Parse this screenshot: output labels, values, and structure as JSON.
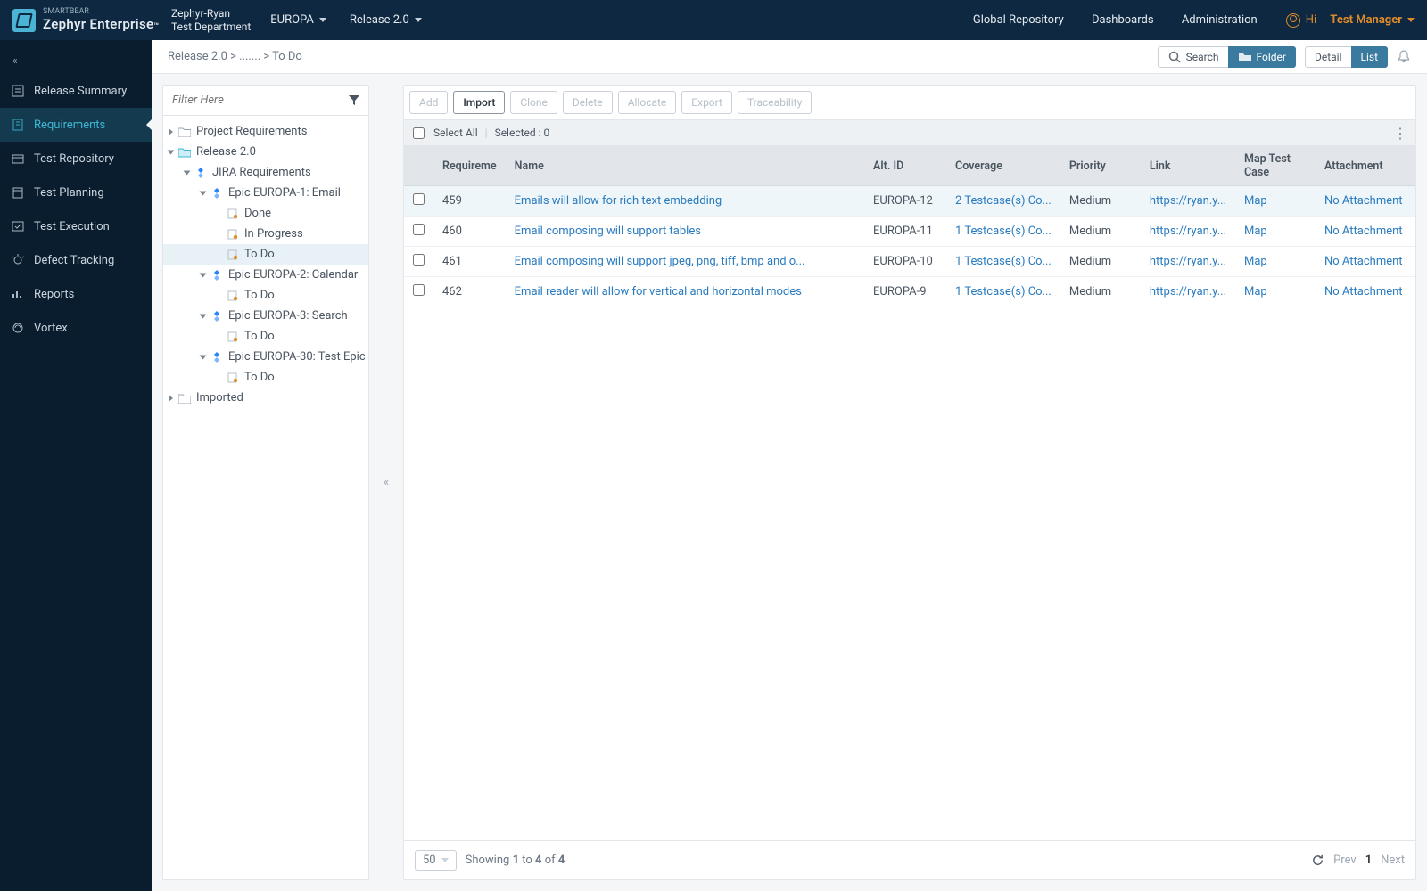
{
  "brand": {
    "small": "SMARTBEAR",
    "name": "Zephyr Enterprise",
    "tm": "™"
  },
  "project": {
    "name": "Zephyr-Ryan",
    "dept": "Test Department"
  },
  "dd1": "EUROPA",
  "dd2": "Release 2.0",
  "topnav": {
    "repo": "Global Repository",
    "dash": "Dashboards",
    "admin": "Administration"
  },
  "user": {
    "greet": "Hi",
    "name": "Test Manager"
  },
  "sidenav": [
    {
      "id": "release-summary",
      "label": "Release Summary"
    },
    {
      "id": "requirements",
      "label": "Requirements"
    },
    {
      "id": "test-repository",
      "label": "Test Repository"
    },
    {
      "id": "test-planning",
      "label": "Test Planning"
    },
    {
      "id": "test-execution",
      "label": "Test Execution"
    },
    {
      "id": "defect-tracking",
      "label": "Defect Tracking"
    },
    {
      "id": "reports",
      "label": "Reports"
    },
    {
      "id": "vortex",
      "label": "Vortex"
    }
  ],
  "breadcrumb": "Release 2.0 > ....... > To Do",
  "searchBtn": "Search",
  "folderBtn": "Folder",
  "detailBtn": "Detail",
  "listBtn": "List",
  "filterPlaceholder": "Filter Here",
  "tree": [
    {
      "d": 0,
      "tw": "closed",
      "ico": "folder",
      "label": "Project Requirements"
    },
    {
      "d": 0,
      "tw": "open",
      "ico": "folder-open",
      "label": "Release 2.0"
    },
    {
      "d": 1,
      "tw": "open",
      "ico": "jira",
      "label": "JIRA Requirements"
    },
    {
      "d": 2,
      "tw": "open",
      "ico": "jira",
      "label": "Epic EUROPA-1: Email"
    },
    {
      "d": 3,
      "tw": "none",
      "ico": "doc",
      "label": "Done"
    },
    {
      "d": 3,
      "tw": "none",
      "ico": "doc",
      "label": "In Progress"
    },
    {
      "d": 3,
      "tw": "none",
      "ico": "doc",
      "label": "To Do",
      "sel": true
    },
    {
      "d": 2,
      "tw": "open",
      "ico": "jira",
      "label": "Epic EUROPA-2: Calendar"
    },
    {
      "d": 3,
      "tw": "none",
      "ico": "doc",
      "label": "To Do"
    },
    {
      "d": 2,
      "tw": "open",
      "ico": "jira",
      "label": "Epic EUROPA-3: Search"
    },
    {
      "d": 3,
      "tw": "none",
      "ico": "doc",
      "label": "To Do"
    },
    {
      "d": 2,
      "tw": "open",
      "ico": "jira",
      "label": "Epic EUROPA-30: Test Epic"
    },
    {
      "d": 3,
      "tw": "none",
      "ico": "doc",
      "label": "To Do"
    },
    {
      "d": 0,
      "tw": "closed",
      "ico": "folder",
      "label": "Imported"
    }
  ],
  "actions": {
    "add": "Add",
    "import": "Import",
    "clone": "Clone",
    "delete": "Delete",
    "allocate": "Allocate",
    "export": "Export",
    "trace": "Traceability"
  },
  "selectAll": "Select All",
  "selected": "Selected : 0",
  "cols": {
    "id": "Requireme",
    "name": "Name",
    "alt": "Alt. ID",
    "cov": "Coverage",
    "pri": "Priority",
    "link": "Link",
    "map": "Map Test Case",
    "att": "Attachment"
  },
  "rows": [
    {
      "id": "459",
      "name": "Emails will allow for rich text embedding",
      "alt": "EUROPA-12",
      "cov": "2 Testcase(s) Co...",
      "pri": "Medium",
      "link": "https://ryan.y...",
      "map": "Map",
      "att": "No Attachment"
    },
    {
      "id": "460",
      "name": "Email composing will support tables",
      "alt": "EUROPA-11",
      "cov": "1 Testcase(s) Co...",
      "pri": "Medium",
      "link": "https://ryan.y...",
      "map": "Map",
      "att": "No Attachment"
    },
    {
      "id": "461",
      "name": "Email composing will support jpeg, png, tiff, bmp and o...",
      "alt": "EUROPA-10",
      "cov": "1 Testcase(s) Co...",
      "pri": "Medium",
      "link": "https://ryan.y...",
      "map": "Map",
      "att": "No Attachment"
    },
    {
      "id": "462",
      "name": "Email reader will allow for vertical and horizontal modes",
      "alt": "EUROPA-9",
      "cov": "1 Testcase(s) Co...",
      "pri": "Medium",
      "link": "https://ryan.y...",
      "map": "Map",
      "att": "No Attachment"
    }
  ],
  "pageSize": "50",
  "showing": {
    "pre": "Showing ",
    "a": "1",
    "mid": " to ",
    "b": "4",
    "of": " of ",
    "c": "4"
  },
  "pager": {
    "prev": "Prev",
    "page": "1",
    "next": "Next"
  }
}
